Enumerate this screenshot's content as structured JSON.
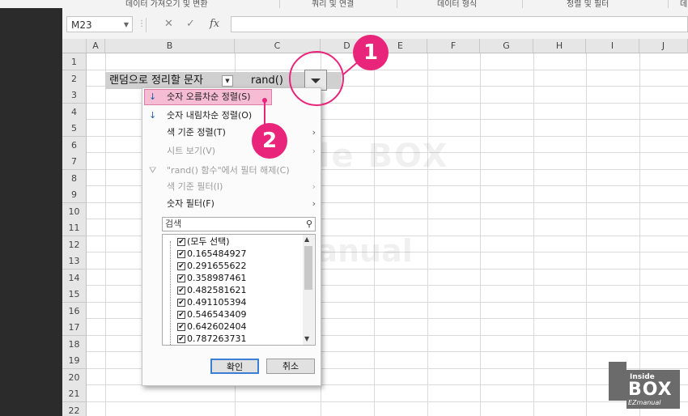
{
  "ribbon": {
    "groups": [
      "데이터 가져오기 및 변환",
      "쿼리 및 연결",
      "데이터 형식",
      "정렬 및 필터",
      "데"
    ]
  },
  "formula_bar": {
    "name_box": "M23",
    "fx": "fx",
    "cancel_symbol": "✕",
    "confirm_symbol": "✓"
  },
  "columns": [
    "A",
    "B",
    "C",
    "D",
    "E",
    "F",
    "G",
    "H",
    "I",
    "J"
  ],
  "rows": [
    "1",
    "2",
    "3",
    "4",
    "5",
    "6",
    "7",
    "8",
    "9",
    "10",
    "11",
    "12",
    "13",
    "14",
    "15",
    "16",
    "17",
    "18",
    "19",
    "20",
    "21",
    "22"
  ],
  "cells": {
    "B2": "랜덤으로 정리할 문자",
    "C2": "rand()"
  },
  "filter_menu": {
    "items": [
      {
        "label": "숫자 오름차순 정렬(S)",
        "icon": "sort-ascending-icon",
        "enabled": true,
        "submenu": false
      },
      {
        "label": "숫자 내림차순 정렬(O)",
        "icon": "sort-descending-icon",
        "enabled": true,
        "submenu": false
      },
      {
        "label": "색 기준 정렬(T)",
        "icon": "",
        "enabled": true,
        "submenu": true
      },
      {
        "label": "시트 보기(V)",
        "icon": "",
        "enabled": false,
        "submenu": true
      },
      {
        "label": "\"rand() 함수\"에서 필터 해제(C)",
        "icon": "clear-filter-icon",
        "enabled": false,
        "submenu": false
      },
      {
        "label": "색 기준 필터(I)",
        "icon": "",
        "enabled": false,
        "submenu": true
      },
      {
        "label": "숫자 필터(F)",
        "icon": "",
        "enabled": true,
        "submenu": true
      }
    ],
    "search_placeholder": "검색",
    "list": [
      {
        "label": "(모두 선택)",
        "checked": true
      },
      {
        "label": "0.165484927",
        "checked": true
      },
      {
        "label": "0.291655622",
        "checked": true
      },
      {
        "label": "0.358987461",
        "checked": true
      },
      {
        "label": "0.482581621",
        "checked": true
      },
      {
        "label": "0.491105394",
        "checked": true
      },
      {
        "label": "0.546543409",
        "checked": true
      },
      {
        "label": "0.642602404",
        "checked": true
      },
      {
        "label": "0.787263731",
        "checked": true
      }
    ],
    "ok_label": "확인",
    "cancel_label": "취소"
  },
  "annotations": {
    "step1": "1",
    "step2": "2",
    "accent_color": "#e8257a"
  },
  "watermark": {
    "line1": "Inside BOX",
    "line2": "EZManual",
    "logo_small": "Inside",
    "logo_big": "BOX",
    "logo_sub": "EZmanual"
  }
}
